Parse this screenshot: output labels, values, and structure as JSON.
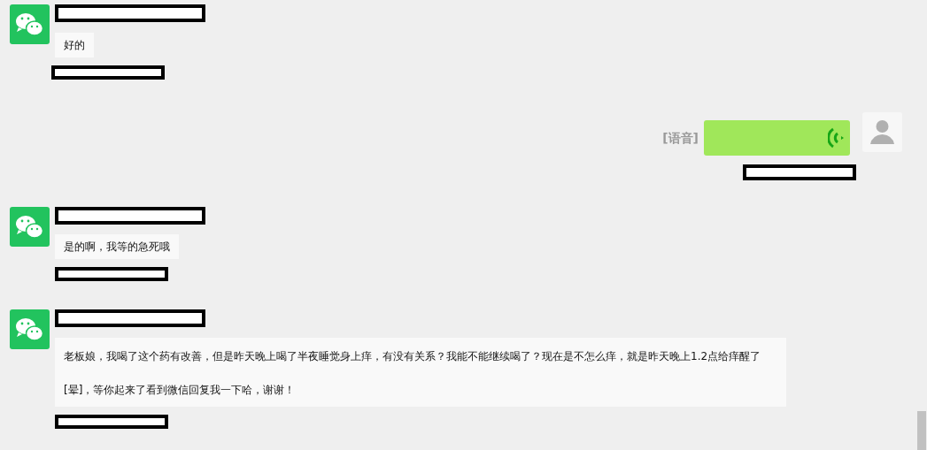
{
  "messages": [
    {
      "kind": "incoming",
      "lines": [
        "好的"
      ]
    },
    {
      "kind": "voice",
      "label": "[语音]"
    },
    {
      "kind": "incoming",
      "lines": [
        "是的啊，我等的急死哦"
      ]
    },
    {
      "kind": "incoming",
      "lines": [
        "老板娘，我喝了这个药有改善，但是昨天晚上喝了半夜睡觉身上痒，有没有关系？我能不能继续喝了？现在是不怎么痒，就是昨天晚上1.2点给痒醒了",
        "[晕]，等你起来了看到微信回复我一下哈，谢谢！"
      ]
    }
  ]
}
